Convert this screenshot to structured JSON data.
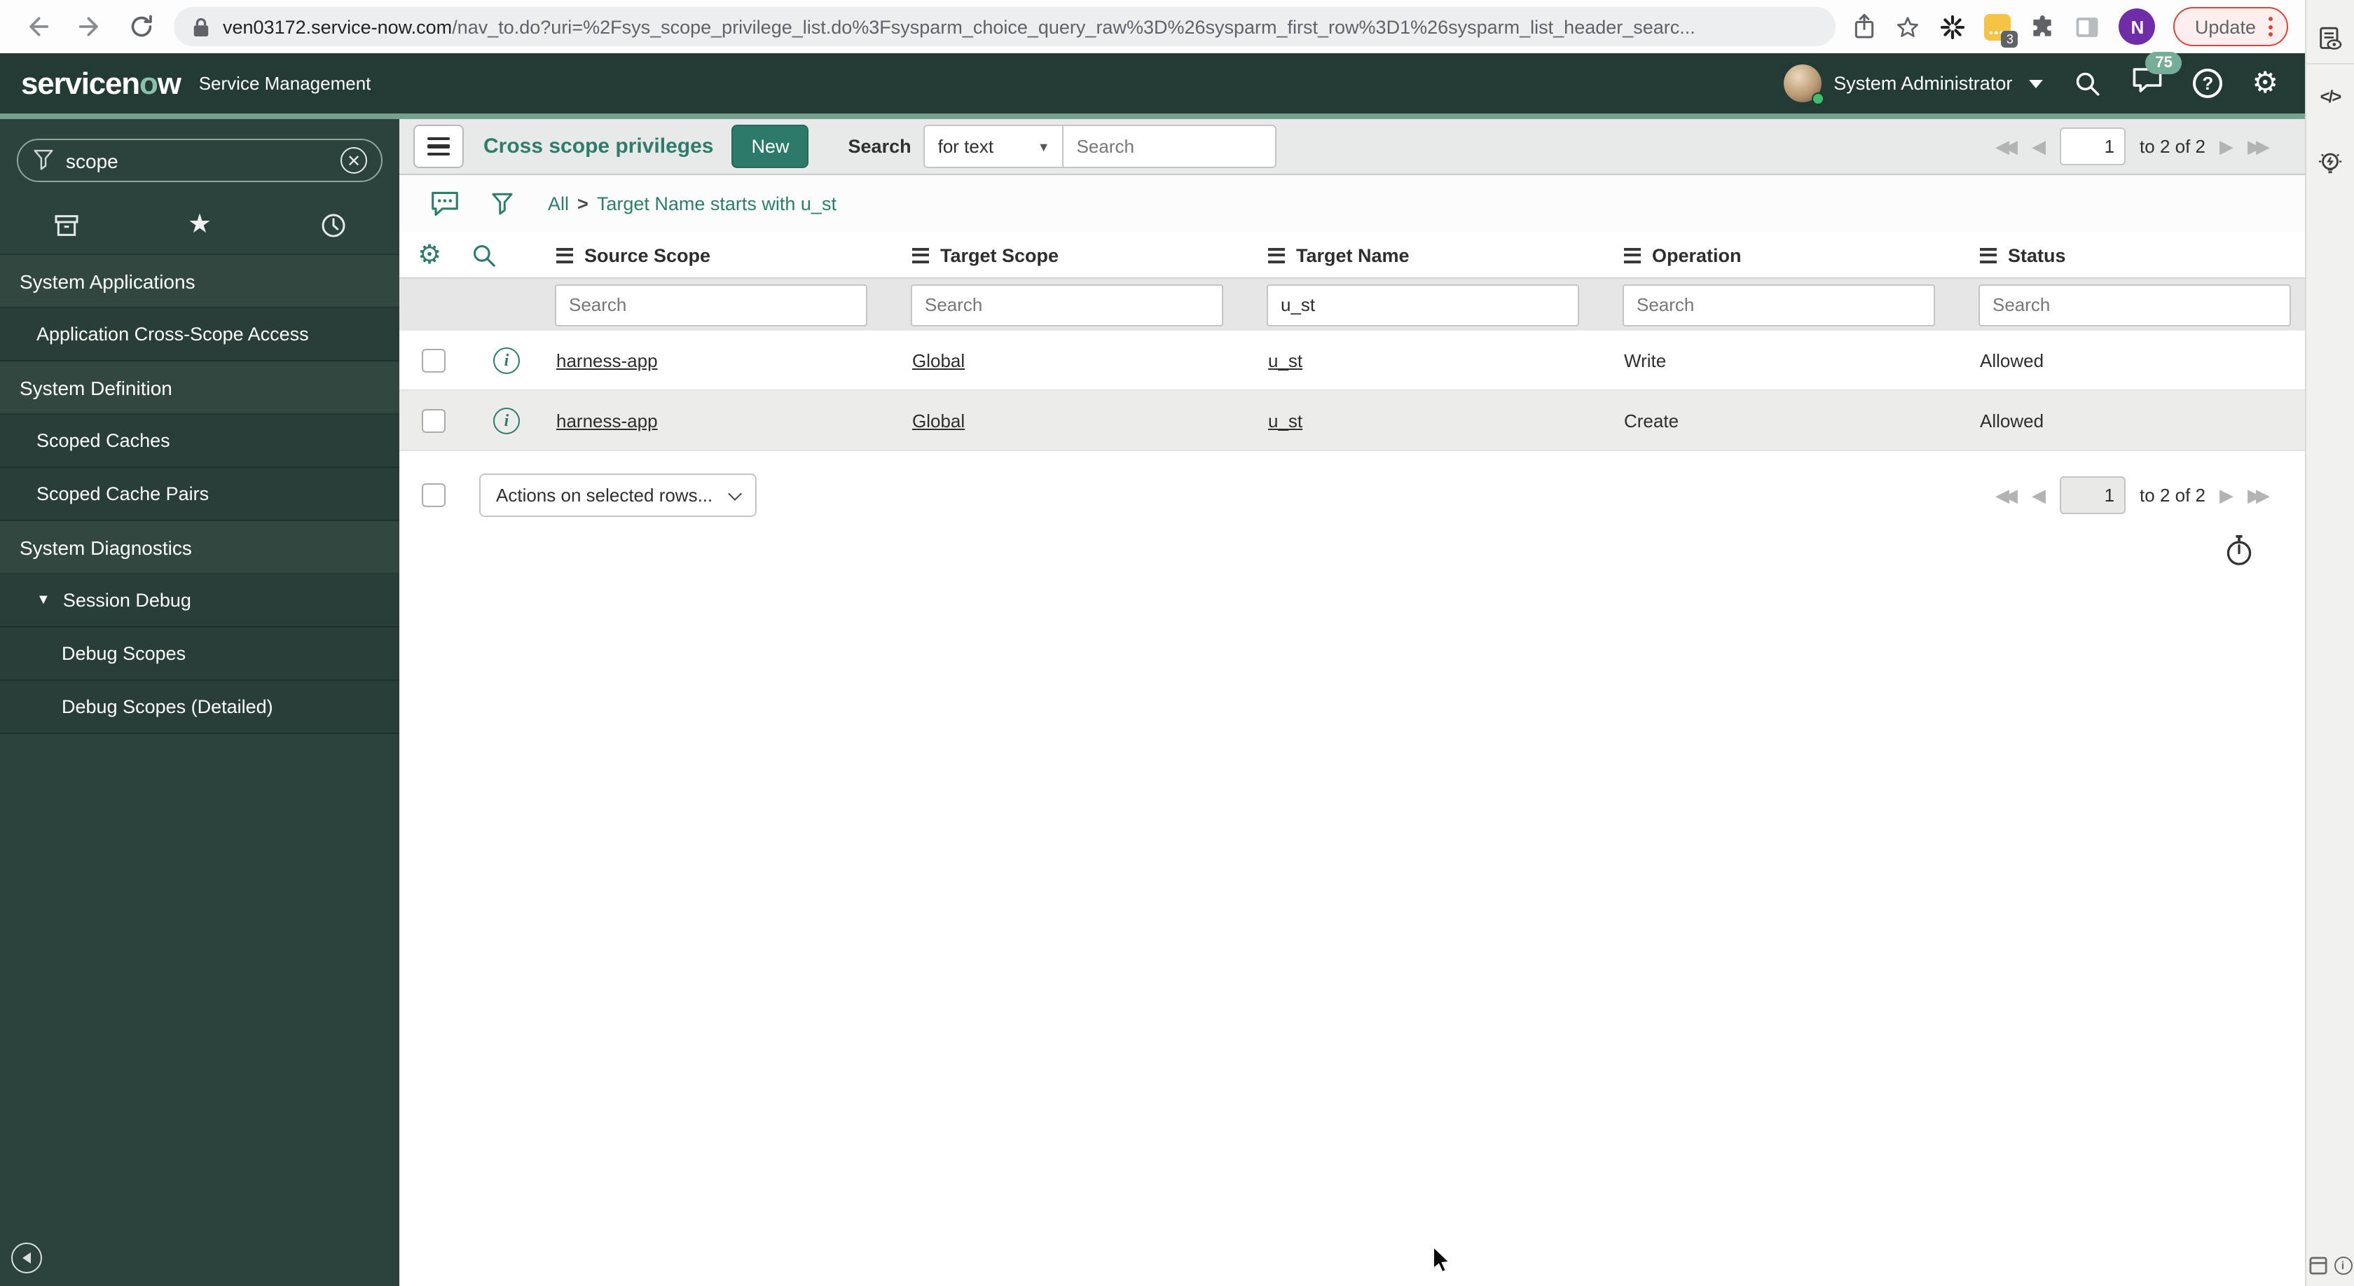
{
  "colors": {
    "accent_teal": "#2e7c6c",
    "header_bg": "#243a34",
    "header_accent_line": "#76a18f",
    "sidebar_bg": "#2c423c",
    "new_button_bg": "#2b7a6a",
    "update_border": "#dc4437",
    "profile_purple": "#6f2da8",
    "notification_badge_green": "#76ad99",
    "extension_yellow": "#f6c445"
  },
  "browser": {
    "url_domain": "ven03172.service-now.com",
    "url_path": "/nav_to.do?uri=%2Fsys_scope_privilege_list.do%3Fsysparm_choice_query_raw%3D%26sysparm_first_row%3D1%26sysparm_list_header_searc...",
    "update_label": "Update",
    "profile_initial": "N",
    "extension_badge_count": "3"
  },
  "right_strip": {
    "code_icon_text": "</>"
  },
  "sn_header": {
    "logo_pre": "servicen",
    "logo_o": "o",
    "logo_post": "w",
    "product_name": "Service Management",
    "user_name": "System Administrator",
    "notification_count": "75"
  },
  "sidebar": {
    "filter_value": "scope",
    "nav": [
      {
        "label": "System Applications",
        "type": "section"
      },
      {
        "label": "Application Cross-Scope Access",
        "type": "item"
      },
      {
        "label": "System Definition",
        "type": "section"
      },
      {
        "label": "Scoped Caches",
        "type": "item"
      },
      {
        "label": "Scoped Cache Pairs",
        "type": "item"
      },
      {
        "label": "System Diagnostics",
        "type": "section"
      },
      {
        "label": "Session Debug",
        "type": "item-expanded"
      },
      {
        "label": "Debug Scopes",
        "type": "subitem"
      },
      {
        "label": "Debug Scopes (Detailed)",
        "type": "subitem"
      }
    ]
  },
  "toolbar": {
    "title": "Cross scope privileges",
    "new_button": "New",
    "search_label": "Search",
    "search_type": "for text",
    "search_placeholder": "Search"
  },
  "breadcrumb": {
    "root": "All",
    "separator": ">",
    "filter": "Target Name starts with u_st"
  },
  "pagination": {
    "page": "1",
    "range_text": "to 2 of 2"
  },
  "list": {
    "columns": [
      "Source Scope",
      "Target Scope",
      "Target Name",
      "Operation",
      "Status"
    ],
    "filter_placeholder": "Search",
    "target_name_filter": "u_st",
    "rows": [
      {
        "source_scope": "harness-app",
        "target_scope": "Global",
        "target_name": "u_st",
        "operation": "Write",
        "status": "Allowed"
      },
      {
        "source_scope": "harness-app",
        "target_scope": "Global",
        "target_name": "u_st",
        "operation": "Create",
        "status": "Allowed"
      }
    ],
    "actions_select": "Actions on selected rows..."
  }
}
